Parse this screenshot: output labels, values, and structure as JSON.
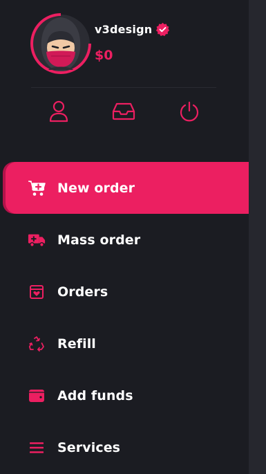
{
  "profile": {
    "username": "v3design",
    "balance": "$0",
    "verified_icon": "verified-badge-icon",
    "avatar_icon": "ninja-avatar-icon"
  },
  "quick_actions": [
    {
      "icon": "user-icon"
    },
    {
      "icon": "inbox-icon"
    },
    {
      "icon": "power-icon"
    }
  ],
  "menu": {
    "items": [
      {
        "label": "New order",
        "icon": "cart-plus-icon",
        "active": true
      },
      {
        "label": "Mass order",
        "icon": "truck-medical-icon",
        "active": false
      },
      {
        "label": "Orders",
        "icon": "box-heart-icon",
        "active": false
      },
      {
        "label": "Refill",
        "icon": "recycle-icon",
        "active": false
      },
      {
        "label": "Add funds",
        "icon": "wallet-icon",
        "active": false
      },
      {
        "label": "Services",
        "icon": "list-icon",
        "active": false
      }
    ]
  },
  "colors": {
    "accent": "#ec1f61",
    "background": "#1b1c22",
    "text": "#ffffff"
  }
}
